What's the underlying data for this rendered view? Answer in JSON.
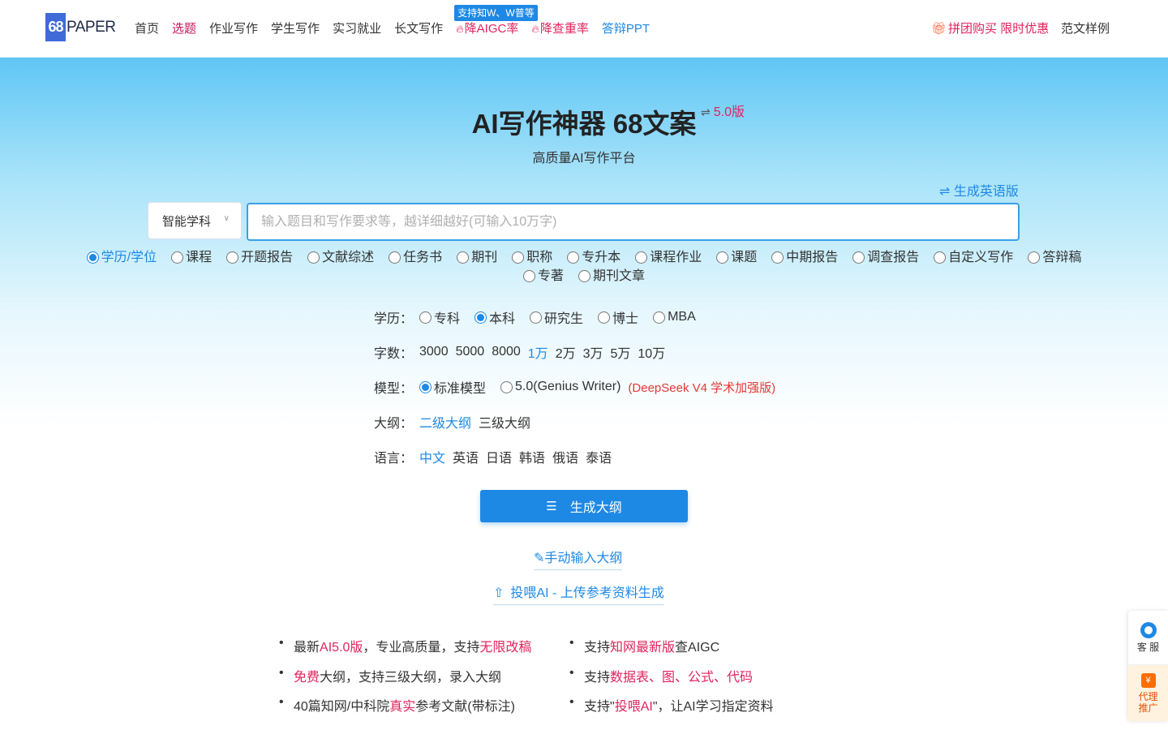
{
  "header": {
    "logo_mark": "68",
    "logo_text": "PAPER",
    "nav": [
      {
        "label": "首页",
        "style": "normal"
      },
      {
        "label": "选题",
        "style": "active"
      },
      {
        "label": "作业写作",
        "style": "normal"
      },
      {
        "label": "学生写作",
        "style": "normal"
      },
      {
        "label": "实习就业",
        "style": "normal"
      },
      {
        "label": "长文写作",
        "style": "normal"
      },
      {
        "label": "降AIGC率",
        "style": "hot",
        "tip": "支持知W、W普等"
      },
      {
        "label": "降查重率",
        "style": "hot"
      },
      {
        "label": "答辩PPT",
        "style": "blue"
      }
    ],
    "promo": "拼团购买 限时优惠",
    "samples": "范文样例"
  },
  "hero": {
    "title": "AI写作神器 68文案",
    "version": "5.0版",
    "subtitle": "高质量AI写作平台",
    "english_toggle": "生成英语版",
    "subject_select": "智能学科",
    "topic_placeholder": "输入题目和写作要求等，越详细越好(可输入10万字)",
    "paper_types": [
      "学历/学位",
      "课程",
      "开题报告",
      "文献综述",
      "任务书",
      "期刊",
      "职称",
      "专升本",
      "课程作业",
      "课题",
      "中期报告",
      "调查报告",
      "自定义写作",
      "答辩稿",
      "专著",
      "期刊文章"
    ],
    "paper_type_selected": "学历/学位"
  },
  "options": {
    "education": {
      "label": "学历：",
      "choices": [
        "专科",
        "本科",
        "研究生",
        "博士",
        "MBA"
      ],
      "selected": "本科"
    },
    "word_count": {
      "label": "字数：",
      "choices": [
        "3000",
        "5000",
        "8000",
        "1万",
        "2万",
        "3万",
        "5万",
        "10万"
      ],
      "selected": "1万"
    },
    "model": {
      "label": "模型：",
      "choices": [
        "标准模型",
        "5.0(Genius Writer)"
      ],
      "selected": "标准模型",
      "note": "(DeepSeek V4 学术加强版)"
    },
    "outline": {
      "label": "大纲：",
      "choices": [
        "二级大纲",
        "三级大纲"
      ],
      "selected": "二级大纲"
    },
    "language": {
      "label": "语言：",
      "choices": [
        "中文",
        "英语",
        "日语",
        "韩语",
        "俄语",
        "泰语"
      ],
      "selected": "中文"
    }
  },
  "actions": {
    "generate": "生成大纲",
    "manual": "手动输入大纲",
    "upload": "投喂AI - 上传参考资料生成"
  },
  "features": {
    "left": [
      [
        {
          "t": "最新"
        },
        {
          "t": "AI5.0版",
          "hl": true
        },
        {
          "t": "，专业高质量，支持"
        },
        {
          "t": "无限改稿",
          "hl": true
        }
      ],
      [
        {
          "t": "免费",
          "hl": true
        },
        {
          "t": "大纲，支持三级大纲，录入大纲"
        }
      ],
      [
        {
          "t": "40篇知网/中科院"
        },
        {
          "t": "真实",
          "hl": true
        },
        {
          "t": "参考文献(带标注)"
        }
      ]
    ],
    "right": [
      [
        {
          "t": "支持"
        },
        {
          "t": "知网最新版",
          "hl": true
        },
        {
          "t": "查AIGC"
        }
      ],
      [
        {
          "t": "支持"
        },
        {
          "t": "数据表、图、公式、代码",
          "hl": true
        }
      ],
      [
        {
          "t": "支持\""
        },
        {
          "t": "投喂AI",
          "hl": true
        },
        {
          "t": "\"，让AI学习指定资料"
        }
      ]
    ]
  },
  "side": {
    "service": "客 服",
    "agent": "代理推广"
  },
  "colors": {
    "accent": "#1e88e5",
    "highlight": "#e0245e",
    "brand": "#3f6ad8"
  }
}
